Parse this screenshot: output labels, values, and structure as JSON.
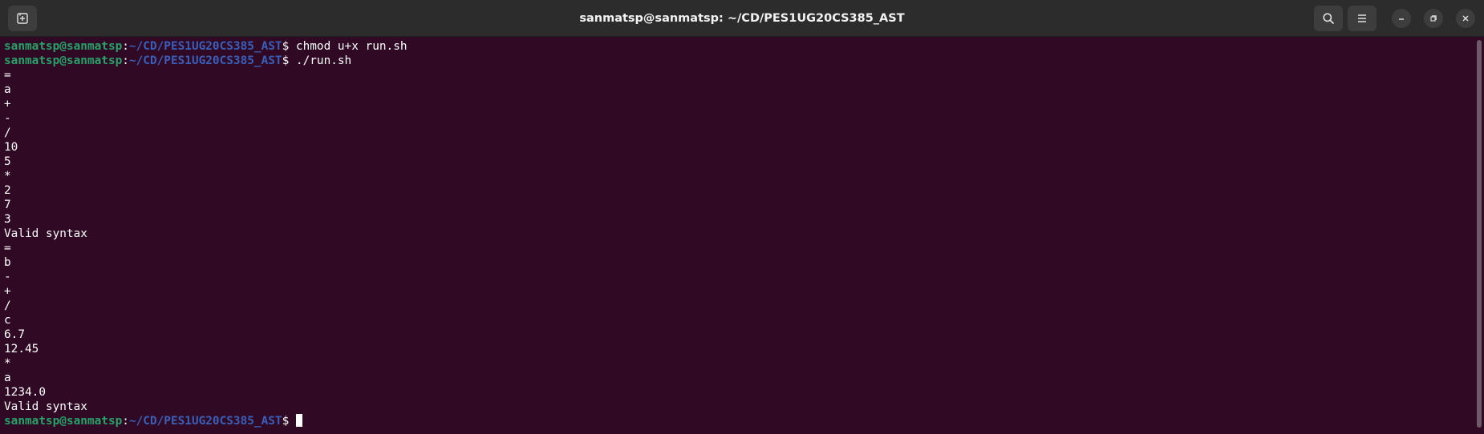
{
  "window": {
    "title": "sanmatsp@sanmatsp: ~/CD/PES1UG20CS385_AST"
  },
  "prompt": {
    "user_host": "sanmatsp@sanmatsp",
    "colon": ":",
    "path": "~/CD/PES1UG20CS385_AST",
    "symbol": "$"
  },
  "commands": {
    "cmd1": " chmod u+x run.sh",
    "cmd2": " ./run.sh"
  },
  "output": [
    "=",
    "a",
    "+",
    "-",
    "/",
    "10",
    "5",
    "*",
    "2",
    "7",
    "3",
    "Valid syntax",
    "=",
    "b",
    "-",
    "+",
    "/",
    "c",
    "6.7",
    "12.45",
    "*",
    "a",
    "1234.0",
    "Valid syntax"
  ],
  "final_prompt_suffix": " ",
  "colors": {
    "background": "#300a24",
    "prompt_user": "#26a269",
    "prompt_path": "#3a5fb8",
    "titlebar": "#2c2c2c"
  },
  "icons": {
    "new_tab": "new-tab-icon",
    "search": "search-icon",
    "menu": "hamburger-menu-icon",
    "minimize": "minimize-icon",
    "maximize": "restore-icon",
    "close": "close-icon"
  }
}
